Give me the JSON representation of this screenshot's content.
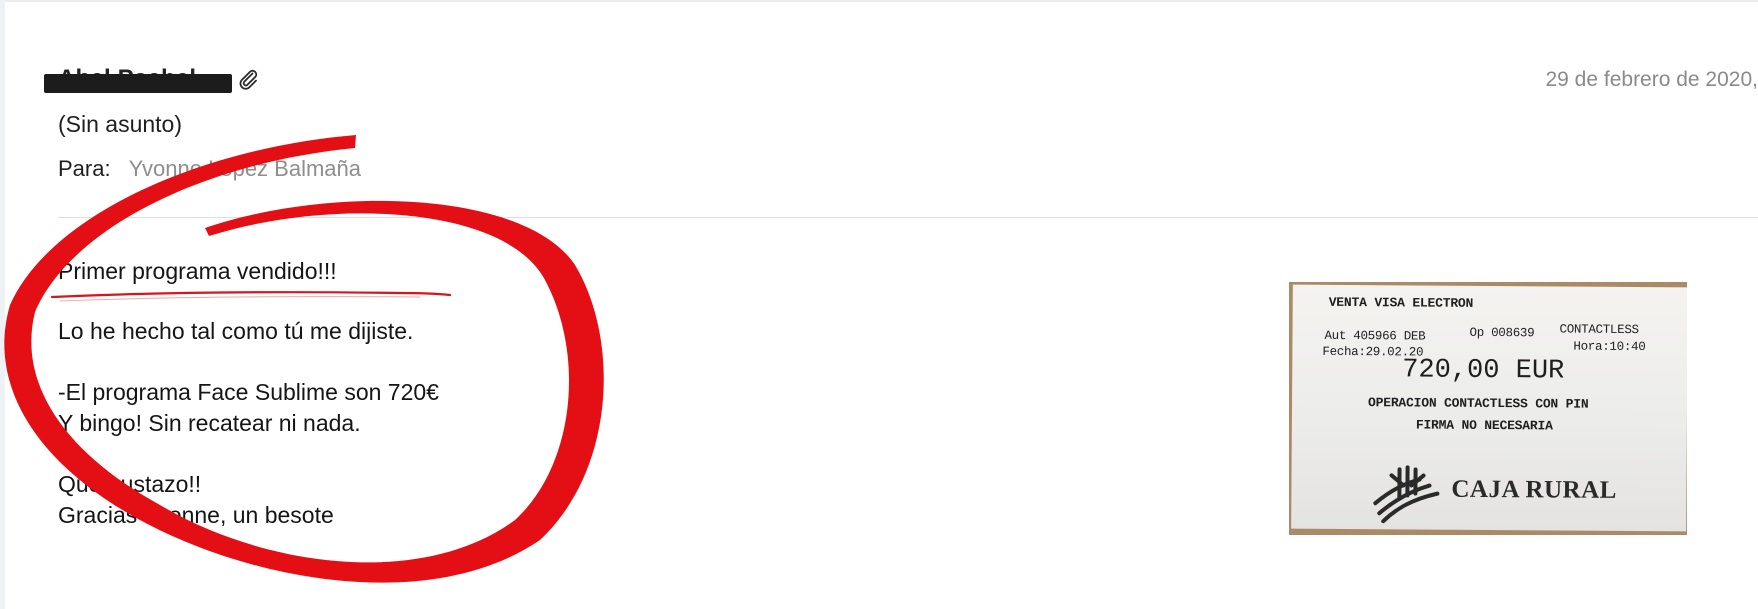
{
  "message": {
    "sender": "Abel Pachel",
    "date": "29 de febrero de 2020,",
    "subject": "(Sin asunto)",
    "recipient_label": "Para:",
    "recipient": "Yvonne López Balmaña",
    "attachment_icon": "paperclip-icon"
  },
  "body": {
    "lines": [
      "Primer programa vendido!!!",
      "Lo he hecho tal como tú me dijiste.",
      "-El programa Face Sublime son 720€",
      "Y bingo! Sin recatear ni nada.",
      "Que gustazo!!",
      "Gracias Yvonne, un besote"
    ]
  },
  "receipt": {
    "header": "VENTA VISA ELECTRON",
    "auth": "Aut 405966 DEB",
    "op": "Op 008639",
    "contactless": "CONTACTLESS",
    "fecha": "Fecha:29.02.20",
    "hora": "Hora:10:40",
    "amount": "720,00 EUR",
    "note1": "OPERACION CONTACTLESS CON PIN",
    "note2": "FIRMA NO NECESARIA",
    "bank": "CAJA RURAL"
  },
  "colors": {
    "annotation_red": "#e40f14",
    "muted_gray": "#8a8a8a"
  }
}
